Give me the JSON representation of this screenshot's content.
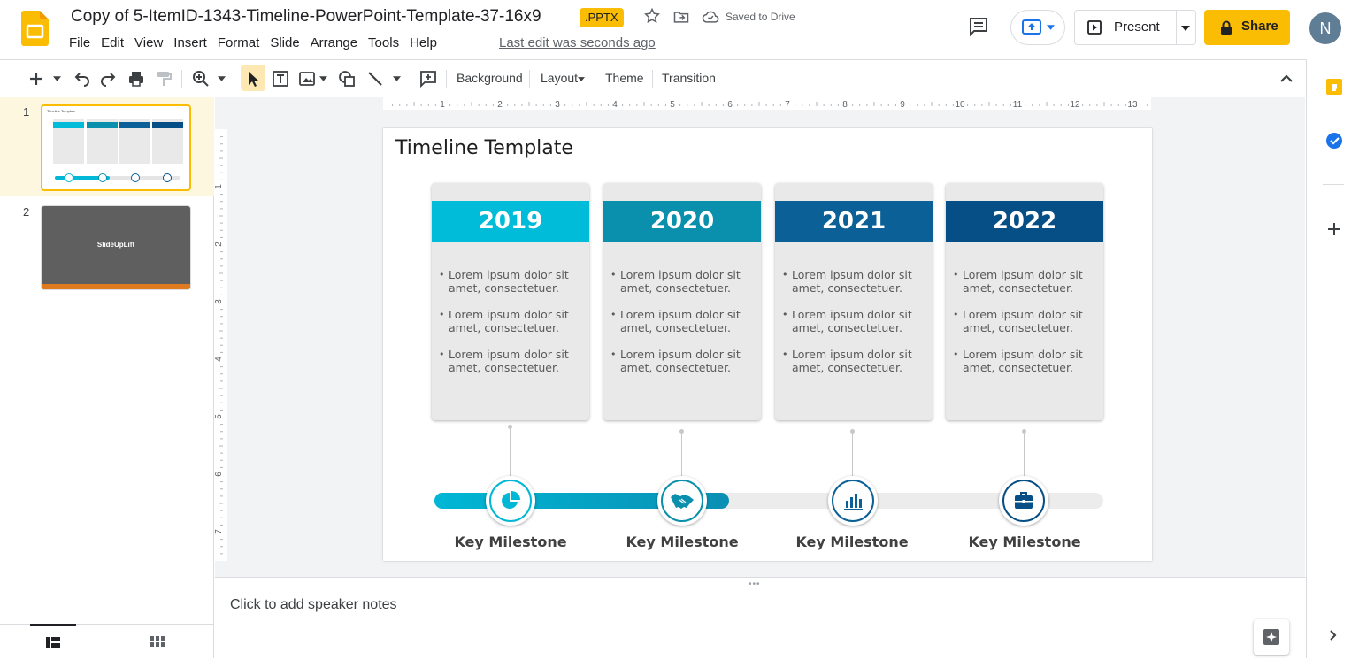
{
  "header": {
    "doc_title": "Copy of 5-ItemID-1343-Timeline-PowerPoint-Template-37-16x9",
    "file_badge": ".PPTX",
    "save_status": "Saved to Drive",
    "last_edit": "Last edit was seconds ago",
    "menu": [
      "File",
      "Edit",
      "View",
      "Insert",
      "Format",
      "Slide",
      "Arrange",
      "Tools",
      "Help"
    ],
    "present_label": "Present",
    "share_label": "Share",
    "avatar_initial": "N"
  },
  "toolbar": {
    "background_label": "Background",
    "layout_label": "Layout",
    "theme_label": "Theme",
    "transition_label": "Transition"
  },
  "filmstrip": {
    "slides": [
      {
        "number": "1",
        "thumb_title": "Timeline Template"
      },
      {
        "number": "2",
        "thumb_label": "SlideUpLift"
      }
    ]
  },
  "ruler": {
    "horizontal_marks": [
      "1",
      "2",
      "3",
      "4",
      "5",
      "6",
      "7",
      "8",
      "9",
      "10",
      "11",
      "12",
      "13"
    ],
    "vertical_marks": [
      "1",
      "2",
      "3",
      "4",
      "5",
      "6",
      "7"
    ]
  },
  "slide": {
    "title": "Timeline Template",
    "cards": [
      {
        "year": "2019",
        "color": "#00bcd8",
        "bullets": [
          "Lorem ipsum dolor sit amet, consectetuer.",
          "Lorem ipsum dolor sit amet, consectetuer.",
          "Lorem ipsum dolor sit amet, consectetuer."
        ]
      },
      {
        "year": "2020",
        "color": "#0a8fac",
        "bullets": [
          "Lorem ipsum dolor sit amet, consectetuer.",
          "Lorem ipsum dolor sit amet, consectetuer.",
          "Lorem ipsum dolor sit amet, consectetuer."
        ]
      },
      {
        "year": "2021",
        "color": "#0b6197",
        "bullets": [
          "Lorem ipsum dolor sit amet, consectetuer.",
          "Lorem ipsum dolor sit amet, consectetuer.",
          "Lorem ipsum dolor sit amet, consectetuer."
        ]
      },
      {
        "year": "2022",
        "color": "#064f86",
        "bullets": [
          "Lorem ipsum dolor sit amet, consectetuer.",
          "Lorem ipsum dolor sit amet, consectetuer.",
          "Lorem ipsum dolor sit amet, consectetuer."
        ]
      }
    ],
    "milestones": [
      {
        "label": "Key Milestone",
        "icon": "pie-chart-icon",
        "color": "#00b7d5"
      },
      {
        "label": "Key Milestone",
        "icon": "handshake-icon",
        "color": "#0a8fac"
      },
      {
        "label": "Key Milestone",
        "icon": "bar-chart-icon",
        "color": "#0b6197"
      },
      {
        "label": "Key Milestone",
        "icon": "briefcase-icon",
        "color": "#064f86"
      }
    ],
    "progress_fraction": 0.44
  },
  "notes": {
    "placeholder": "Click to add speaker notes"
  },
  "colors": {
    "accent": "#fbbc04",
    "canvas_bg": "#f1f3f4"
  }
}
